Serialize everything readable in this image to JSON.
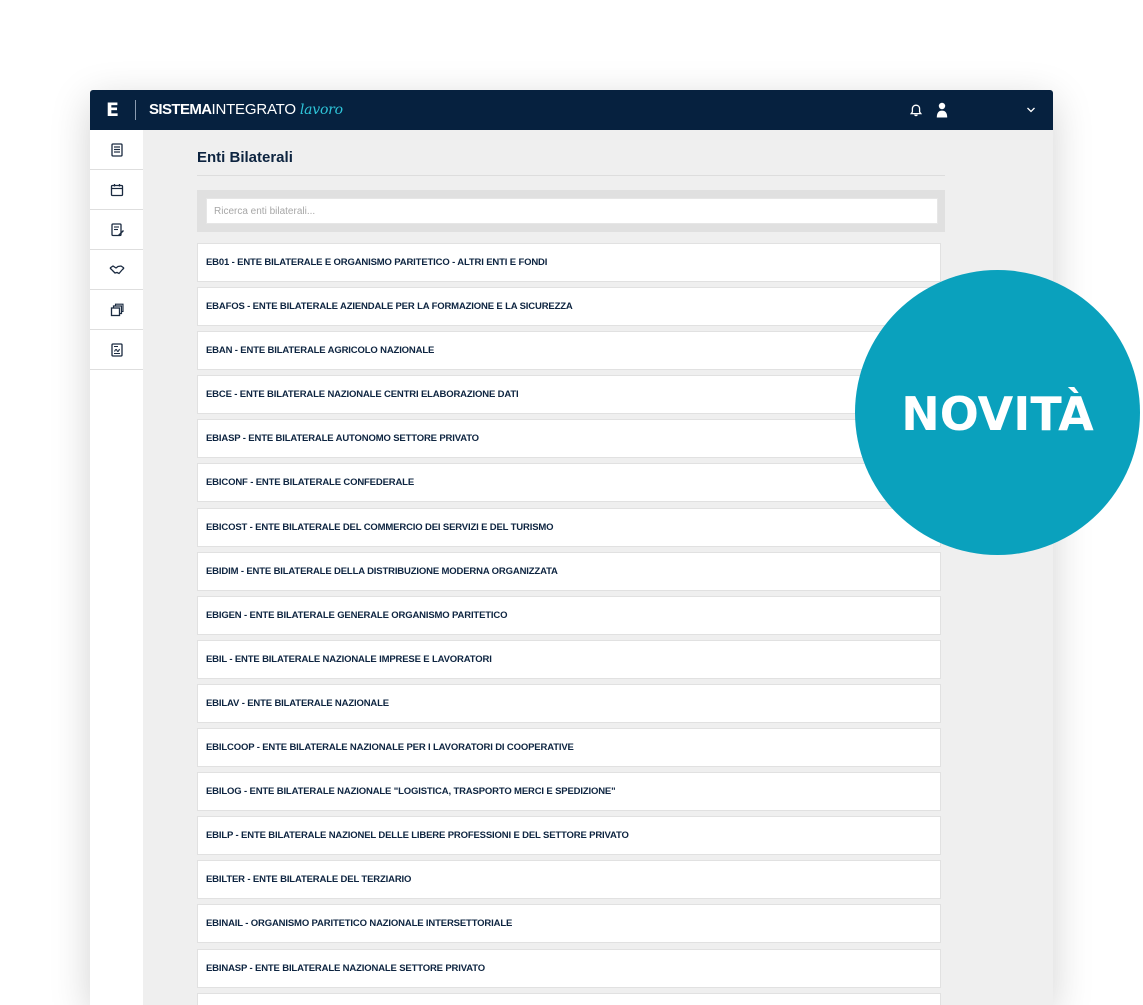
{
  "app": {
    "brand_mark": "E",
    "brand_part1": "SISTEMA",
    "brand_part2": "INTEGRATO",
    "brand_part3": "lavoro"
  },
  "header_icons": [
    "bell-icon",
    "user-icon",
    "chevron-down-icon"
  ],
  "sidebar": {
    "items": [
      {
        "icon": "document-icon"
      },
      {
        "icon": "calendar-icon"
      },
      {
        "icon": "edit-document-icon"
      },
      {
        "icon": "handshake-icon"
      },
      {
        "icon": "stack-icon"
      },
      {
        "icon": "contract-icon"
      }
    ]
  },
  "main": {
    "title": "Enti Bilaterali",
    "search_placeholder": "Ricerca enti bilaterali...",
    "items": [
      "EB01 - ENTE BILATERALE E ORGANISMO PARITETICO - ALTRI ENTI E FONDI",
      "EBAFOS - ENTE BILATERALE AZIENDALE PER LA FORMAZIONE E LA SICUREZZA",
      "EBAN - ENTE BILATERALE AGRICOLO NAZIONALE",
      "EBCE - ENTE BILATERALE NAZIONALE CENTRI ELABORAZIONE DATI",
      "EBIASP - ENTE BILATERALE AUTONOMO SETTORE PRIVATO",
      "EBICONF - ENTE BILATERALE CONFEDERALE",
      "EBICOST - ENTE BILATERALE DEL COMMERCIO DEI SERVIZI E DEL TURISMO",
      "EBIDIM - ENTE BILATERALE DELLA DISTRIBUZIONE MODERNA ORGANIZZATA",
      "EBIGEN - ENTE BILATERALE GENERALE ORGANISMO PARITETICO",
      "EBIL - ENTE BILATERALE NAZIONALE IMPRESE E LAVORATORI",
      "EBILAV - ENTE BILATERALE NAZIONALE",
      "EBILCOOP - ENTE BILATERALE NAZIONALE PER I LAVORATORI DI COOPERATIVE",
      "EBILOG - ENTE BILATERALE NAZIONALE \"LOGISTICA, TRASPORTO MERCI E SPEDIZIONE\"",
      "EBILP - ENTE BILATERALE NAZIONEL DELLE LIBERE PROFESSIONI E DEL SETTORE PRIVATO",
      "EBILTER - ENTE BILATERALE DEL TERZIARIO",
      "EBINAIL - ORGANISMO PARITETICO NAZIONALE INTERSETTORIALE",
      "EBINASP - ENTE BILATERALE NAZIONALE SETTORE PRIVATO",
      ""
    ]
  },
  "badge": {
    "text": "NOVITÀ",
    "color": "#0aa1bd"
  },
  "colors": {
    "topbar": "#06213f",
    "accent": "#2ec4d8",
    "text_dark": "#0d2440"
  }
}
